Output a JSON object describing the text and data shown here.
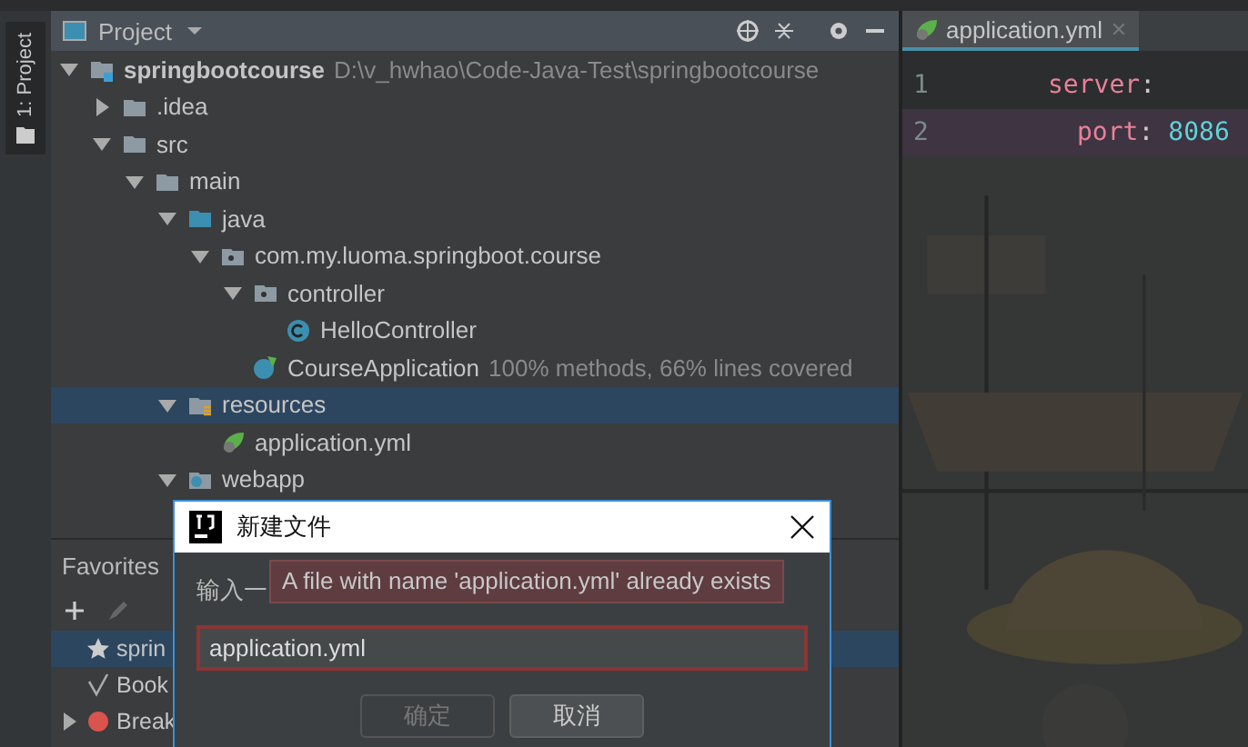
{
  "tool_strip": {
    "label": "1: Project"
  },
  "project": {
    "title": "Project",
    "tree": [
      {
        "label": "springbootcourse",
        "kind": "module",
        "note": "D:\\v_hwhao\\Code-Java-Test\\springbootcourse",
        "expanded": true,
        "selected": false,
        "children": [
          {
            "label": ".idea",
            "kind": "folder",
            "expanded": false,
            "selected": false
          },
          {
            "label": "src",
            "kind": "folder",
            "expanded": true,
            "selected": false,
            "children": [
              {
                "label": "main",
                "kind": "folder",
                "expanded": true,
                "selected": false,
                "children": [
                  {
                    "label": "java",
                    "kind": "source",
                    "expanded": true,
                    "selected": false,
                    "children": [
                      {
                        "label": "com.my.luoma.springboot.course",
                        "kind": "package",
                        "expanded": true,
                        "selected": false,
                        "children": [
                          {
                            "label": "controller",
                            "kind": "package",
                            "expanded": true,
                            "selected": false,
                            "children": [
                              {
                                "label": "HelloController",
                                "kind": "class",
                                "selected": false
                              }
                            ]
                          },
                          {
                            "label": "CourseApplication",
                            "kind": "spring",
                            "note": "100% methods, 66% lines covered",
                            "selected": false
                          }
                        ]
                      }
                    ]
                  },
                  {
                    "label": "resources",
                    "kind": "resources",
                    "expanded": true,
                    "selected": true,
                    "children": [
                      {
                        "label": "application.yml",
                        "kind": "yml",
                        "selected": false
                      }
                    ]
                  },
                  {
                    "label": "webapp",
                    "kind": "web",
                    "expanded": true,
                    "selected": false
                  }
                ]
              }
            ]
          }
        ]
      }
    ]
  },
  "favorites": {
    "title": "Favorites",
    "items": [
      {
        "label": "sprin",
        "kind": "star",
        "selected": true
      },
      {
        "label": "Book",
        "kind": "check",
        "selected": false
      },
      {
        "label": "Break",
        "kind": "dot",
        "selected": false,
        "expanded": false
      }
    ]
  },
  "editor": {
    "tab": "application.yml",
    "lines": [
      {
        "number": "1",
        "key": "server",
        "colon": ":",
        "current": false,
        "children": [
          {
            "number": "2",
            "key": "port",
            "colon": ":",
            "value": "8086",
            "current": true
          }
        ]
      }
    ]
  },
  "dialog": {
    "title": "新建文件",
    "label": "输入一",
    "error": "A file with name 'application.yml' already exists",
    "value": "application.yml",
    "buttons": [
      {
        "label": "确定",
        "disabled": true
      },
      {
        "label": "取消",
        "disabled": false
      }
    ]
  }
}
